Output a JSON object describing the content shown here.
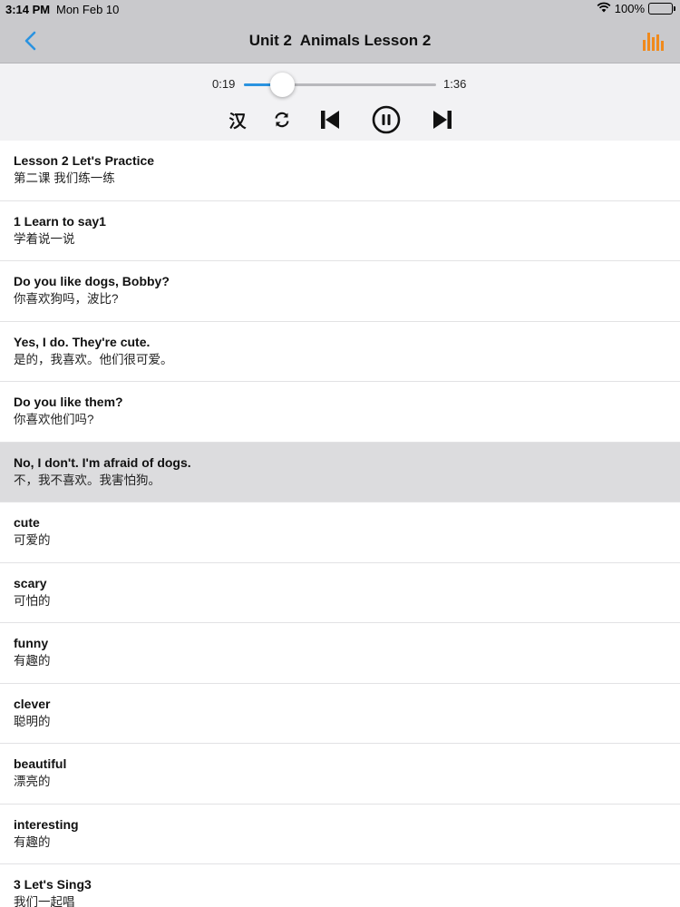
{
  "status": {
    "time": "3:14 PM",
    "date": "Mon Feb 10",
    "battery": "100%"
  },
  "nav": {
    "title": "Unit 2  Animals Lesson 2",
    "accent": "#2a93e0",
    "eq_color": "#f08a1c"
  },
  "player": {
    "current_time": "0:19",
    "total_time": "1:36",
    "progress": 0.2,
    "han_label": "汉"
  },
  "rows": [
    {
      "en": "Lesson 2 Let's Practice",
      "zh": "第二课 我们练一练"
    },
    {
      "en": "1 Learn to say1",
      "zh": "学着说一说"
    },
    {
      "en": "Do you like dogs, Bobby?",
      "zh": "你喜欢狗吗，波比?"
    },
    {
      "en": "Yes, I do. They're cute.",
      "zh": "是的，我喜欢。他们很可爱。"
    },
    {
      "en": "Do you like them?",
      "zh": "你喜欢他们吗?"
    },
    {
      "en": "No, I don't. I'm afraid of dogs.",
      "zh": "不，我不喜欢。我害怕狗。",
      "active": true
    },
    {
      "en": "cute",
      "zh": "可爱的"
    },
    {
      "en": "scary",
      "zh": "可怕的"
    },
    {
      "en": "funny",
      "zh": "有趣的"
    },
    {
      "en": "clever",
      "zh": "聪明的"
    },
    {
      "en": "beautiful",
      "zh": "漂亮的"
    },
    {
      "en": "interesting",
      "zh": "有趣的"
    },
    {
      "en": "3 Let's Sing3",
      "zh": "我们一起唱"
    }
  ]
}
